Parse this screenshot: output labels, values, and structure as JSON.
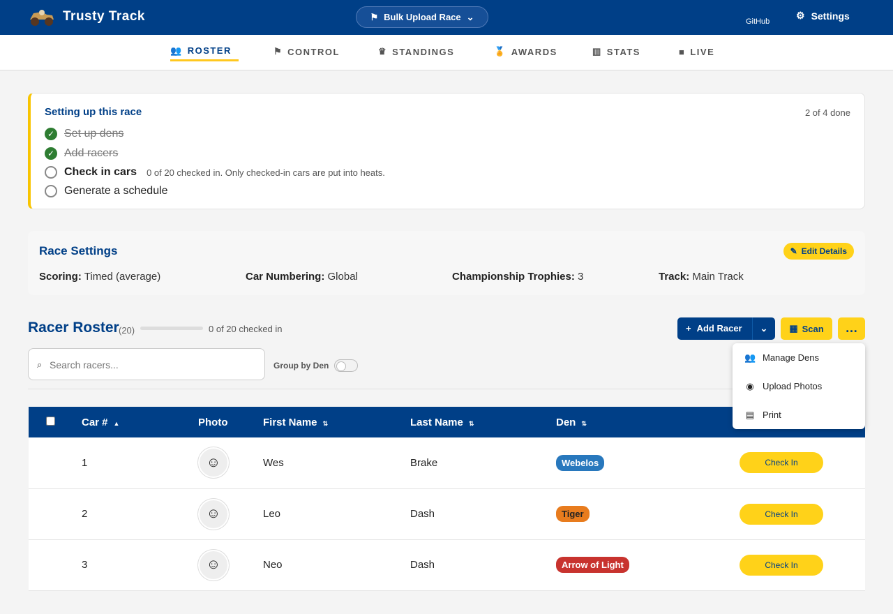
{
  "app": {
    "title": "Trusty Track",
    "race": "Bulk Upload Race",
    "github": "GitHub",
    "settings": "Settings"
  },
  "tabs": [
    "ROSTER",
    "CONTROL",
    "STANDINGS",
    "AWARDS",
    "STATS",
    "LIVE"
  ],
  "setup": {
    "title": "Setting up this race",
    "progress": "2 of 4 done",
    "steps": [
      "Set up dens",
      "Add racers",
      "Check in cars",
      "Generate a schedule"
    ],
    "note": "0 of 20 checked in. Only checked-in cars are put into heats."
  },
  "race_settings": {
    "title": "Race Settings",
    "edit": "Edit Details",
    "items": [
      {
        "label": "Scoring:",
        "value": "Timed (average)"
      },
      {
        "label": "Car Numbering:",
        "value": "Global"
      },
      {
        "label": "Championship Trophies:",
        "value": "3"
      },
      {
        "label": "Track:",
        "value": "Main Track"
      }
    ]
  },
  "roster": {
    "title": "Racer Roster",
    "count": "(20)",
    "checked": "0 of 20 checked in",
    "add": "Add Racer",
    "scan": "Scan",
    "search_placeholder": "Search racers...",
    "group": "Group by Den",
    "menu": [
      "Manage Dens",
      "Upload Photos",
      "Print"
    ],
    "columns": [
      "Car #",
      "Photo",
      "First Name",
      "Last Name",
      "Den"
    ],
    "rows": [
      {
        "car": "1",
        "first": "Wes",
        "last": "Brake",
        "den": "Webelos",
        "den_color": "#2878bd",
        "action": "Check In"
      },
      {
        "car": "2",
        "first": "Leo",
        "last": "Dash",
        "den": "Tiger",
        "den_color": "#e87c1e",
        "action": "Check In"
      },
      {
        "car": "3",
        "first": "Neo",
        "last": "Dash",
        "den": "Arrow of Light",
        "den_color": "#c8332e",
        "action": "Check In"
      }
    ]
  }
}
